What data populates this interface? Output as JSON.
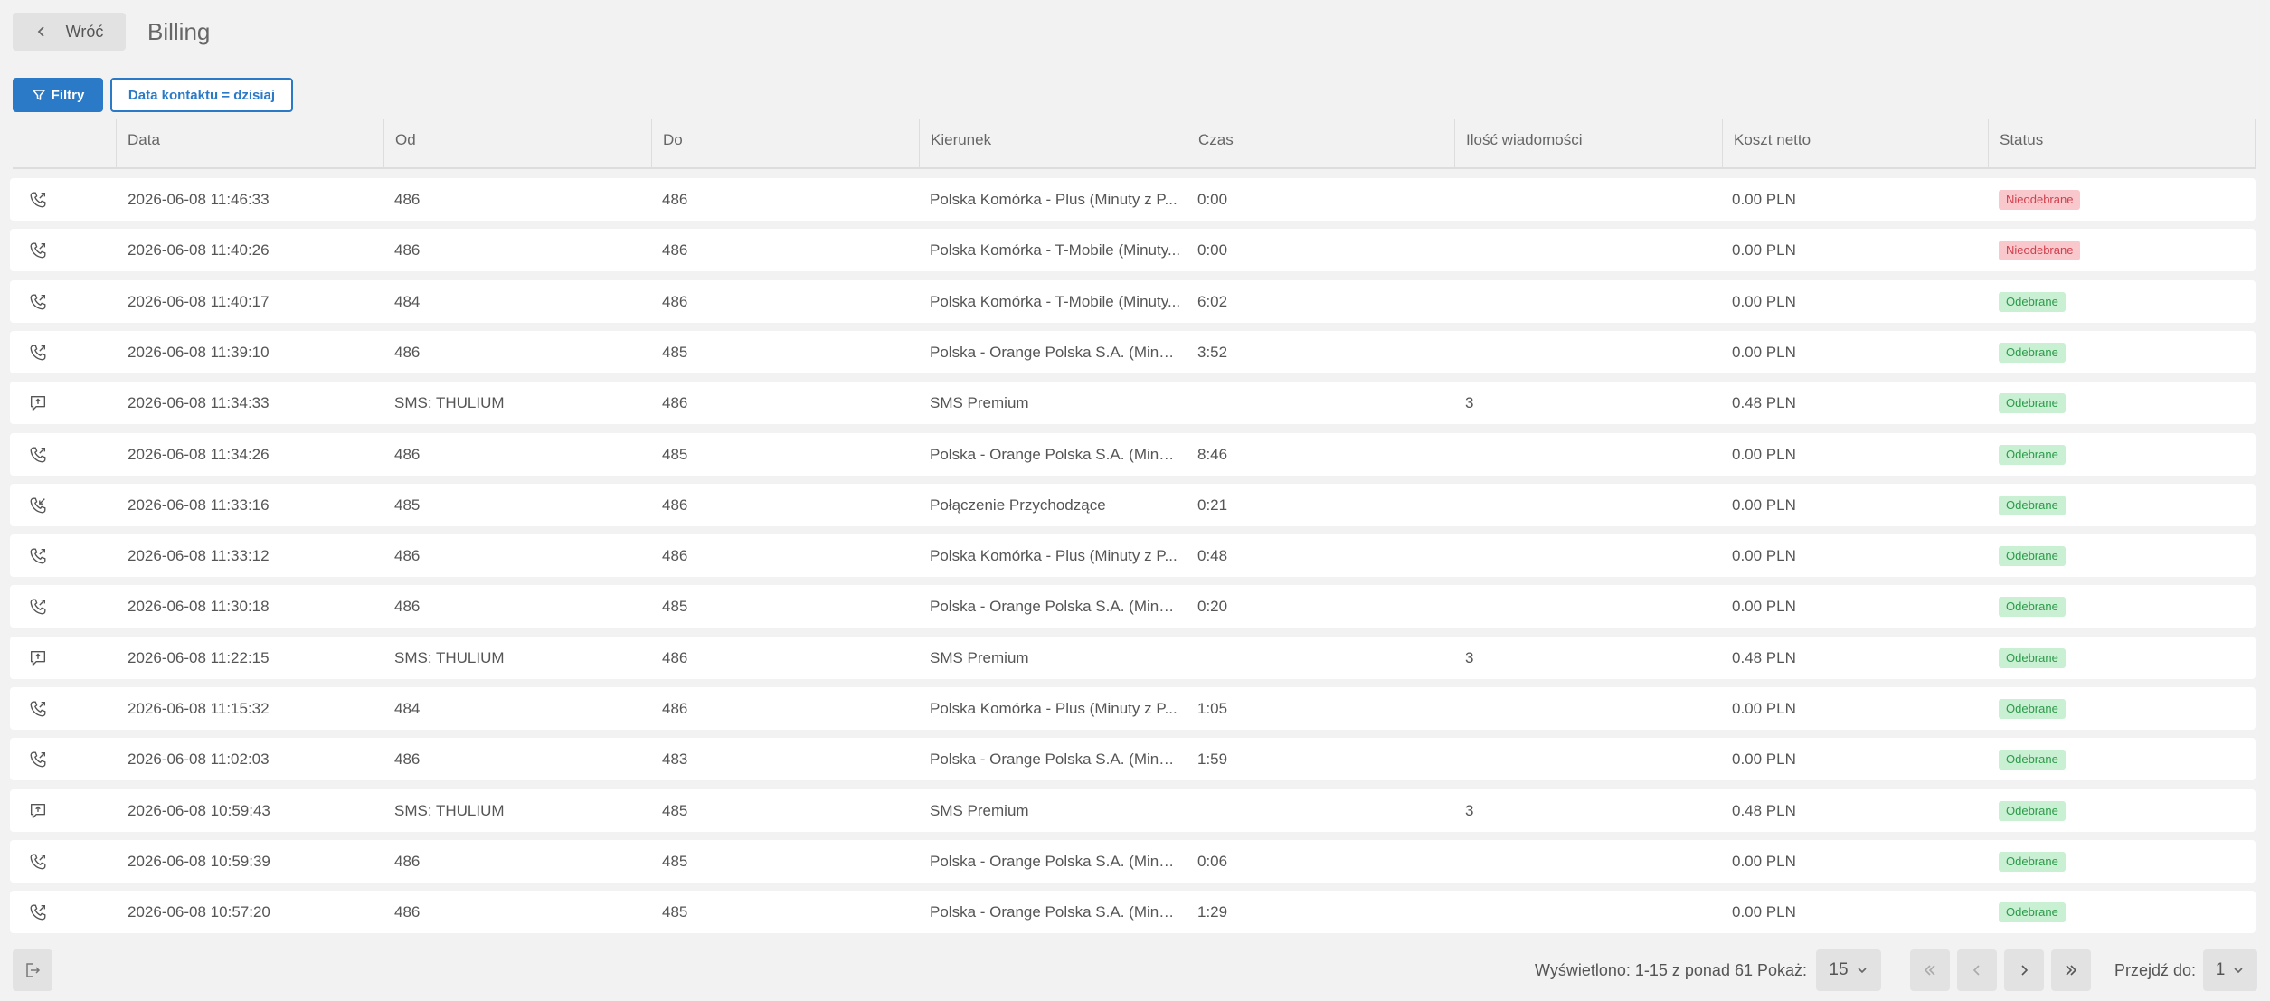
{
  "header": {
    "back_label": "Wróć",
    "title": "Billing"
  },
  "filters": {
    "button_label": "Filtry",
    "active_filter": "Data kontaktu = dzisiaj"
  },
  "columns": [
    "Data",
    "Od",
    "Do",
    "Kierunek",
    "Czas",
    "Ilość wiadomości",
    "Koszt netto",
    "Status"
  ],
  "rows": [
    {
      "icon": "phone-outgoing-icon",
      "data": "2026-06-08 11:46:33",
      "od": "486",
      "do": "486",
      "kierunek": "Polska Komórka - Plus (Minuty z P...",
      "czas": "0:00",
      "ilosc": "",
      "koszt": "0.00 PLN",
      "status": "Nieodebrane",
      "status_type": "no"
    },
    {
      "icon": "phone-outgoing-icon",
      "data": "2026-06-08 11:40:26",
      "od": "486",
      "do": "486",
      "kierunek": "Polska Komórka - T-Mobile (Minuty...",
      "czas": "0:00",
      "ilosc": "",
      "koszt": "0.00 PLN",
      "status": "Nieodebrane",
      "status_type": "no"
    },
    {
      "icon": "phone-outgoing-icon",
      "data": "2026-06-08 11:40:17",
      "od": "484",
      "do": "486",
      "kierunek": "Polska Komórka - T-Mobile (Minuty...",
      "czas": "6:02",
      "ilosc": "",
      "koszt": "0.00 PLN",
      "status": "Odebrane",
      "status_type": "ok"
    },
    {
      "icon": "phone-outgoing-icon",
      "data": "2026-06-08 11:39:10",
      "od": "486",
      "do": "485",
      "kierunek": "Polska - Orange Polska S.A. (Minut...",
      "czas": "3:52",
      "ilosc": "",
      "koszt": "0.00 PLN",
      "status": "Odebrane",
      "status_type": "ok"
    },
    {
      "icon": "sms-outgoing-icon",
      "data": "2026-06-08 11:34:33",
      "od": "SMS: THULIUM",
      "do": "486",
      "kierunek": "SMS Premium",
      "czas": "",
      "ilosc": "3",
      "koszt": "0.48 PLN",
      "status": "Odebrane",
      "status_type": "ok"
    },
    {
      "icon": "phone-outgoing-icon",
      "data": "2026-06-08 11:34:26",
      "od": "486",
      "do": "485",
      "kierunek": "Polska - Orange Polska S.A. (Minut...",
      "czas": "8:46",
      "ilosc": "",
      "koszt": "0.00 PLN",
      "status": "Odebrane",
      "status_type": "ok"
    },
    {
      "icon": "phone-incoming-icon",
      "data": "2026-06-08 11:33:16",
      "od": "485",
      "do": "486",
      "kierunek": "Połączenie Przychodzące",
      "czas": "0:21",
      "ilosc": "",
      "koszt": "0.00 PLN",
      "status": "Odebrane",
      "status_type": "ok"
    },
    {
      "icon": "phone-outgoing-icon",
      "data": "2026-06-08 11:33:12",
      "od": "486",
      "do": "486",
      "kierunek": "Polska Komórka - Plus (Minuty z P...",
      "czas": "0:48",
      "ilosc": "",
      "koszt": "0.00 PLN",
      "status": "Odebrane",
      "status_type": "ok"
    },
    {
      "icon": "phone-outgoing-icon",
      "data": "2026-06-08 11:30:18",
      "od": "486",
      "do": "485",
      "kierunek": "Polska - Orange Polska S.A. (Minut...",
      "czas": "0:20",
      "ilosc": "",
      "koszt": "0.00 PLN",
      "status": "Odebrane",
      "status_type": "ok"
    },
    {
      "icon": "sms-outgoing-icon",
      "data": "2026-06-08 11:22:15",
      "od": "SMS: THULIUM",
      "do": "486",
      "kierunek": "SMS Premium",
      "czas": "",
      "ilosc": "3",
      "koszt": "0.48 PLN",
      "status": "Odebrane",
      "status_type": "ok"
    },
    {
      "icon": "phone-outgoing-icon",
      "data": "2026-06-08 11:15:32",
      "od": "484",
      "do": "486",
      "kierunek": "Polska Komórka - Plus (Minuty z P...",
      "czas": "1:05",
      "ilosc": "",
      "koszt": "0.00 PLN",
      "status": "Odebrane",
      "status_type": "ok"
    },
    {
      "icon": "phone-outgoing-icon",
      "data": "2026-06-08 11:02:03",
      "od": "486",
      "do": "483",
      "kierunek": "Polska - Orange Polska S.A. (Minut...",
      "czas": "1:59",
      "ilosc": "",
      "koszt": "0.00 PLN",
      "status": "Odebrane",
      "status_type": "ok"
    },
    {
      "icon": "sms-outgoing-icon",
      "data": "2026-06-08 10:59:43",
      "od": "SMS: THULIUM",
      "do": "485",
      "kierunek": "SMS Premium",
      "czas": "",
      "ilosc": "3",
      "koszt": "0.48 PLN",
      "status": "Odebrane",
      "status_type": "ok"
    },
    {
      "icon": "phone-outgoing-icon",
      "data": "2026-06-08 10:59:39",
      "od": "486",
      "do": "485",
      "kierunek": "Polska - Orange Polska S.A. (Minut...",
      "czas": "0:06",
      "ilosc": "",
      "koszt": "0.00 PLN",
      "status": "Odebrane",
      "status_type": "ok"
    },
    {
      "icon": "phone-outgoing-icon",
      "data": "2026-06-08 10:57:20",
      "od": "486",
      "do": "485",
      "kierunek": "Polska - Orange Polska S.A. (Minut...",
      "czas": "1:29",
      "ilosc": "",
      "koszt": "0.00 PLN",
      "status": "Odebrane",
      "status_type": "ok"
    }
  ],
  "footer": {
    "summary": "Wyświetlono: 1-15 z ponad 61",
    "show_label": "Pokaż:",
    "show_value": "15",
    "goto_label": "Przejdź do:",
    "goto_value": "1"
  },
  "colors": {
    "accent": "#2a7ac7",
    "status_ok_bg": "#c9f0d2",
    "status_no_bg": "#f8c8cc"
  }
}
